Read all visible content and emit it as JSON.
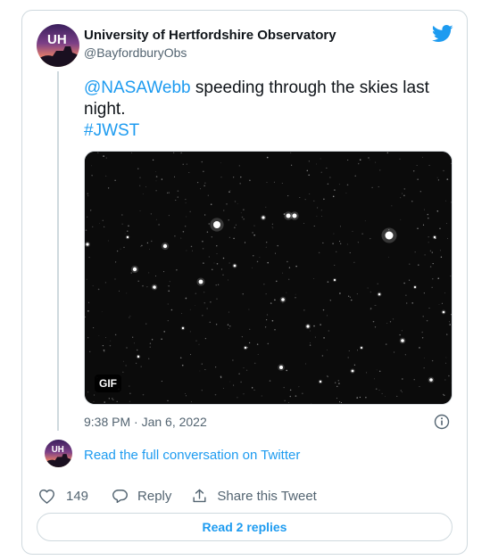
{
  "author": {
    "name": "University of Hertfordshire Observatory",
    "handle": "@BayfordburyObs",
    "avatar_text": "UH"
  },
  "tweet": {
    "mention": "@NASAWebb",
    "text": " speeding through the skies last night.",
    "hashtag": "#JWST",
    "media_badge": "GIF",
    "timestamp": "9:38 PM · Jan 6, 2022"
  },
  "conversation_link": "Read the full conversation on Twitter",
  "actions": {
    "like_count": "149",
    "reply_label": "Reply",
    "share_label": "Share this Tweet"
  },
  "read_replies_label": "Read 2 replies",
  "colors": {
    "link": "#1d9bf0",
    "muted": "#536471",
    "border": "#cfd9de",
    "text": "#0f1419"
  },
  "icons": [
    "twitter-bird-icon",
    "info-icon",
    "heart-icon",
    "reply-bubble-icon",
    "share-icon"
  ]
}
